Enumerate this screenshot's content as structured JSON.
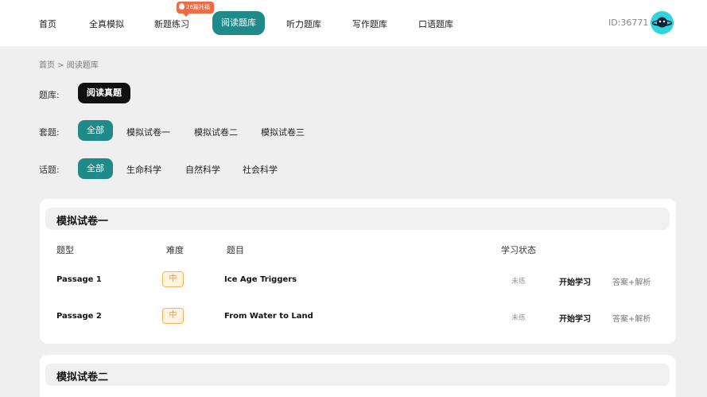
{
  "nav": {
    "items": [
      "首页",
      "全真模拟",
      "新题练习",
      "阅读题库",
      "听力题库",
      "写作题库",
      "口语题库"
    ],
    "active": "阅读题库",
    "badge": "26篇托福",
    "user_id": "ID:36771"
  },
  "breadcrumb": "首页 > 阅读题库",
  "filters": {
    "bank": {
      "label": "题库:",
      "selected": "阅读真题"
    },
    "set": {
      "label": "套题:",
      "options": [
        "全部",
        "模拟试卷一",
        "模拟试卷二",
        "模拟试卷三"
      ],
      "selected": "全部"
    },
    "topic": {
      "label": "话题:",
      "options": [
        "全部",
        "生命科学",
        "自然科学",
        "社会科学"
      ],
      "selected": "全部"
    }
  },
  "papers": [
    {
      "title": "模拟试卷一",
      "columns": [
        "题型",
        "难度",
        "题目",
        "学习状态"
      ],
      "rows": [
        {
          "type": "Passage 1",
          "difficulty": "中",
          "topic": "Ice Age Triggers",
          "status": "未练",
          "action": "开始学习",
          "answer": "答案+解析"
        },
        {
          "type": "Passage 2",
          "difficulty": "中",
          "topic": "From Water to Land",
          "status": "未练",
          "action": "开始学习",
          "answer": "答案+解析"
        }
      ]
    },
    {
      "title": "模拟试卷二"
    }
  ],
  "colors": {
    "accent": "#1f8a8a",
    "badge": "#f06a43",
    "difficulty": "#e89a36",
    "avatar": "#32d3df"
  },
  "icons": {
    "badge": "flame-icon",
    "avatar": "planet-avatar-icon"
  }
}
